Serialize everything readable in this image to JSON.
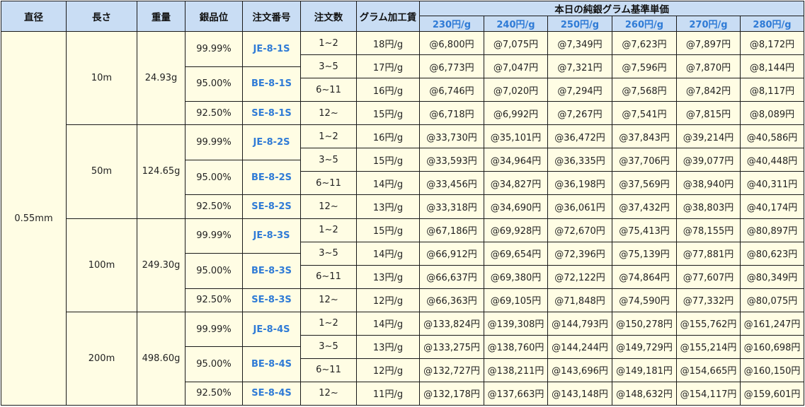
{
  "headers": {
    "diameter": "直径",
    "length": "長さ",
    "weight": "重量",
    "purity": "銀品位",
    "order_no": "注文番号",
    "qty": "注文数",
    "fee": "グラム加工賃",
    "base_group": "本日の純銀グラム基準単価",
    "base_prices": [
      "230円/g",
      "240円/g",
      "250円/g",
      "260円/g",
      "270円/g",
      "280円/g"
    ]
  },
  "diameter": "0.55mm",
  "groups": [
    {
      "length": "10m",
      "weight": "24.93g",
      "items": [
        {
          "purity": "99.99%",
          "order": "JE-8-1S"
        },
        {
          "purity": "95.00%",
          "order": "BE-8-1S"
        },
        {
          "purity": "92.50%",
          "order": "SE-8-1S"
        }
      ],
      "rows": [
        {
          "qty": "1~2",
          "fee": "18円/g",
          "prices": [
            "@6,800円",
            "@7,075円",
            "@7,349円",
            "@7,623円",
            "@7,897円",
            "@8,172円"
          ]
        },
        {
          "qty": "3~5",
          "fee": "17円/g",
          "prices": [
            "@6,773円",
            "@7,047円",
            "@7,321円",
            "@7,596円",
            "@7,870円",
            "@8,144円"
          ]
        },
        {
          "qty": "6~11",
          "fee": "16円/g",
          "prices": [
            "@6,746円",
            "@7,020円",
            "@7,294円",
            "@7,568円",
            "@7,842円",
            "@8,117円"
          ]
        },
        {
          "qty": "12~",
          "fee": "15円/g",
          "prices": [
            "@6,718円",
            "@6,992円",
            "@7,267円",
            "@7,541円",
            "@7,815円",
            "@8,089円"
          ]
        }
      ]
    },
    {
      "length": "50m",
      "weight": "124.65g",
      "items": [
        {
          "purity": "99.99%",
          "order": "JE-8-2S"
        },
        {
          "purity": "95.00%",
          "order": "BE-8-2S"
        },
        {
          "purity": "92.50%",
          "order": "SE-8-2S"
        }
      ],
      "rows": [
        {
          "qty": "1~2",
          "fee": "16円/g",
          "prices": [
            "@33,730円",
            "@35,101円",
            "@36,472円",
            "@37,843円",
            "@39,214円",
            "@40,586円"
          ]
        },
        {
          "qty": "3~5",
          "fee": "15円/g",
          "prices": [
            "@33,593円",
            "@34,964円",
            "@36,335円",
            "@37,706円",
            "@39,077円",
            "@40,448円"
          ]
        },
        {
          "qty": "6~11",
          "fee": "14円/g",
          "prices": [
            "@33,456円",
            "@34,827円",
            "@36,198円",
            "@37,569円",
            "@38,940円",
            "@40,311円"
          ]
        },
        {
          "qty": "12~",
          "fee": "13円/g",
          "prices": [
            "@33,318円",
            "@34,690円",
            "@36,061円",
            "@37,432円",
            "@38,803円",
            "@40,174円"
          ]
        }
      ]
    },
    {
      "length": "100m",
      "weight": "249.30g",
      "items": [
        {
          "purity": "99.99%",
          "order": "JE-8-3S"
        },
        {
          "purity": "95.00%",
          "order": "BE-8-3S"
        },
        {
          "purity": "92.50%",
          "order": "SE-8-3S"
        }
      ],
      "rows": [
        {
          "qty": "1~2",
          "fee": "15円/g",
          "prices": [
            "@67,186円",
            "@69,928円",
            "@72,670円",
            "@75,413円",
            "@78,155円",
            "@80,897円"
          ]
        },
        {
          "qty": "3~5",
          "fee": "14円/g",
          "prices": [
            "@66,912円",
            "@69,654円",
            "@72,396円",
            "@75,139円",
            "@77,881円",
            "@80,623円"
          ]
        },
        {
          "qty": "6~11",
          "fee": "13円/g",
          "prices": [
            "@66,637円",
            "@69,380円",
            "@72,122円",
            "@74,864円",
            "@77,607円",
            "@80,349円"
          ]
        },
        {
          "qty": "12~",
          "fee": "12円/g",
          "prices": [
            "@66,363円",
            "@69,105円",
            "@71,848円",
            "@74,590円",
            "@77,332円",
            "@80,075円"
          ]
        }
      ]
    },
    {
      "length": "200m",
      "weight": "498.60g",
      "items": [
        {
          "purity": "99.99%",
          "order": "JE-8-4S"
        },
        {
          "purity": "95.00%",
          "order": "BE-8-4S"
        },
        {
          "purity": "92.50%",
          "order": "SE-8-4S"
        }
      ],
      "rows": [
        {
          "qty": "1~2",
          "fee": "14円/g",
          "prices": [
            "@133,824円",
            "@139,308円",
            "@144,793円",
            "@150,278円",
            "@155,762円",
            "@161,247円"
          ]
        },
        {
          "qty": "3~5",
          "fee": "13円/g",
          "prices": [
            "@133,275円",
            "@138,760円",
            "@144,244円",
            "@149,729円",
            "@155,214円",
            "@160,698円"
          ]
        },
        {
          "qty": "6~11",
          "fee": "12円/g",
          "prices": [
            "@132,727円",
            "@138,211円",
            "@143,696円",
            "@149,181円",
            "@154,665円",
            "@160,150円"
          ]
        },
        {
          "qty": "12~",
          "fee": "11円/g",
          "prices": [
            "@132,178円",
            "@137,663円",
            "@143,148円",
            "@148,632円",
            "@154,117円",
            "@159,601円"
          ]
        }
      ]
    }
  ]
}
